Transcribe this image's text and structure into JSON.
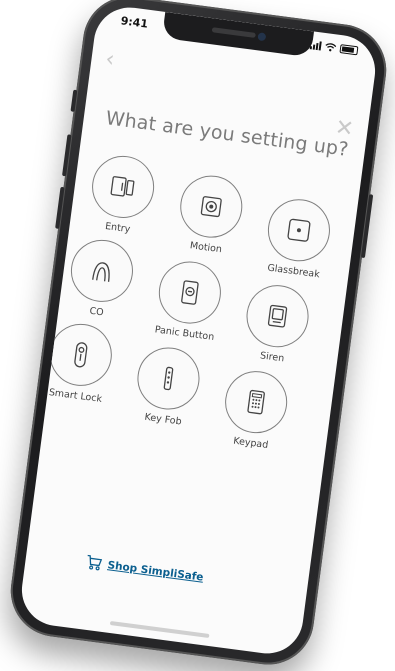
{
  "status_bar": {
    "time": "9:41"
  },
  "header": {
    "title": "What are you setting up?"
  },
  "devices": [
    {
      "label": "Entry",
      "icon": "entry-sensor-icon"
    },
    {
      "label": "Motion",
      "icon": "motion-sensor-icon"
    },
    {
      "label": "Glassbreak",
      "icon": "glassbreak-sensor-icon"
    },
    {
      "label": "CO",
      "icon": "co-detector-icon"
    },
    {
      "label": "Panic Button",
      "icon": "panic-button-icon"
    },
    {
      "label": "Siren",
      "icon": "siren-icon"
    },
    {
      "label": "Smart Lock",
      "icon": "smart-lock-icon"
    },
    {
      "label": "Key Fob",
      "icon": "key-fob-icon"
    },
    {
      "label": "Keypad",
      "icon": "keypad-icon"
    }
  ],
  "footer": {
    "shop_label": "Shop SimpliSafe"
  },
  "colors": {
    "accent": "#0b5f8f",
    "circle_stroke": "#7f7f7f",
    "title_text": "#7a7a7a"
  }
}
